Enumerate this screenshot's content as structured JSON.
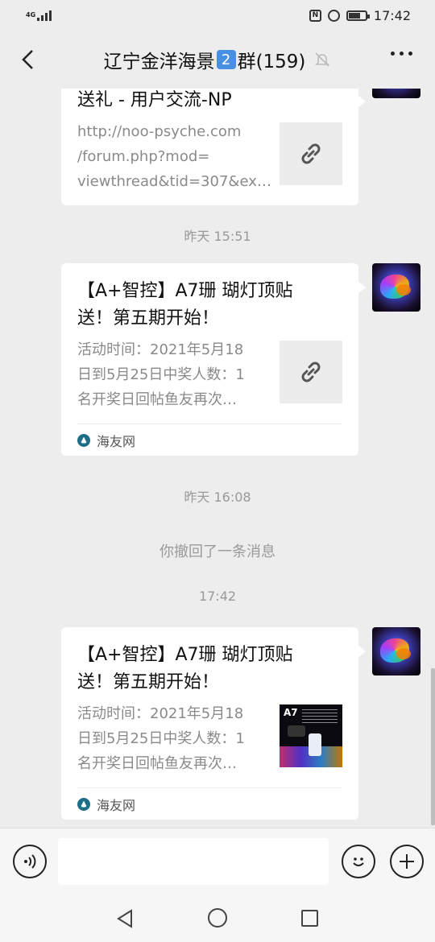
{
  "status_bar": {
    "network_label": "4G",
    "time": "17:42",
    "battery_level": 0.7
  },
  "header": {
    "title_prefix": "辽宁金洋海景",
    "title_badge": "2",
    "title_suffix": "群(159)"
  },
  "messages": [
    {
      "type": "link_card",
      "title": "送礼 - 用户交流-NP",
      "description": "http://noo-psyche.com\n/forum.php?mod=\nviewthread&tid=307&ex…",
      "thumbnail": "link-icon"
    },
    {
      "type": "timestamp",
      "text": "昨天 15:51"
    },
    {
      "type": "link_card",
      "title": "【A+智控】A7珊 瑚灯顶贴送！第五期开始！",
      "description": "活动时间：2021年5月18日到5月25日中奖人数：1名开奖日回帖鱼友再次…",
      "thumbnail": "link-icon",
      "source": "海友网"
    },
    {
      "type": "timestamp",
      "text": "昨天 16:08"
    },
    {
      "type": "system",
      "text": "你撤回了一条消息"
    },
    {
      "type": "timestamp",
      "text": "17:42"
    },
    {
      "type": "link_card",
      "title": "【A+智控】A7珊 瑚灯顶贴送！第五期开始！",
      "description": "活动时间：2021年5月18日到5月25日中奖人数：1名开奖日回帖鱼友再次…",
      "thumbnail": "product-image",
      "thumbnail_text": "A7",
      "source": "海友网"
    }
  ],
  "input_bar": {
    "placeholder": ""
  },
  "icons": {
    "back": "chevron-left-icon",
    "mute": "mute-bell-icon",
    "more": "more-horizontal-icon",
    "voice": "voice-icon",
    "emoji": "emoji-icon",
    "plus": "plus-icon"
  },
  "colors": {
    "background": "#ededed",
    "card": "#ffffff",
    "badge": "#4a90e2"
  }
}
